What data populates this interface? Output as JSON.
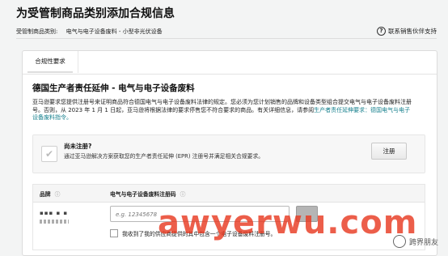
{
  "page": {
    "title": "为受管制商品类别添加合规信息",
    "category_label": "受管制商品类别:",
    "category_value": "电气与电子设备废料 - 小型非光伏设备",
    "help_link": "联系销售伙伴支持",
    "help_icon": "question-circle-icon"
  },
  "tabs": [
    {
      "label": "合规性要求"
    }
  ],
  "section": {
    "title": "德国生产者责任延伸 - 电气与电子设备废料",
    "description": "亚马逊要求您提供注册号来证明商品符合德国电气与电子设备废料法律的规定。您必须为您计划销售的品牌和设备类型组合提交电气与电子设备废料注册号。否则，从 2023 年 1 月 1 日起，亚马逊将根据法律的要求停售您不符合要求的商品。有关详细信息，请参阅",
    "link_text": "生产者责任延伸要求：德国电气与电子设备废料指令。"
  },
  "notice": {
    "title": "尚未注册?",
    "text": "通过亚马逊解决方案获取您的生产者责任延伸 (EPR) 注册号并满足相关合规要求。",
    "button": "注册"
  },
  "table": {
    "col_brand": "品牌",
    "col_reg": "电气与电子设备废料注册码",
    "help_icon": "ⓘ",
    "brand_value": "▪▪▪ ▪ ▪",
    "reg_placeholder": "e.g. 12345678",
    "confirm_text": "我收到了我的供应商提供的其中包含一个电子设备废料注册号。"
  },
  "watermark": {
    "text": "awyerwu.com",
    "logo_text": "跨界朋友"
  },
  "colors": {
    "link": "#157f8c",
    "watermark": "#e83a22"
  }
}
